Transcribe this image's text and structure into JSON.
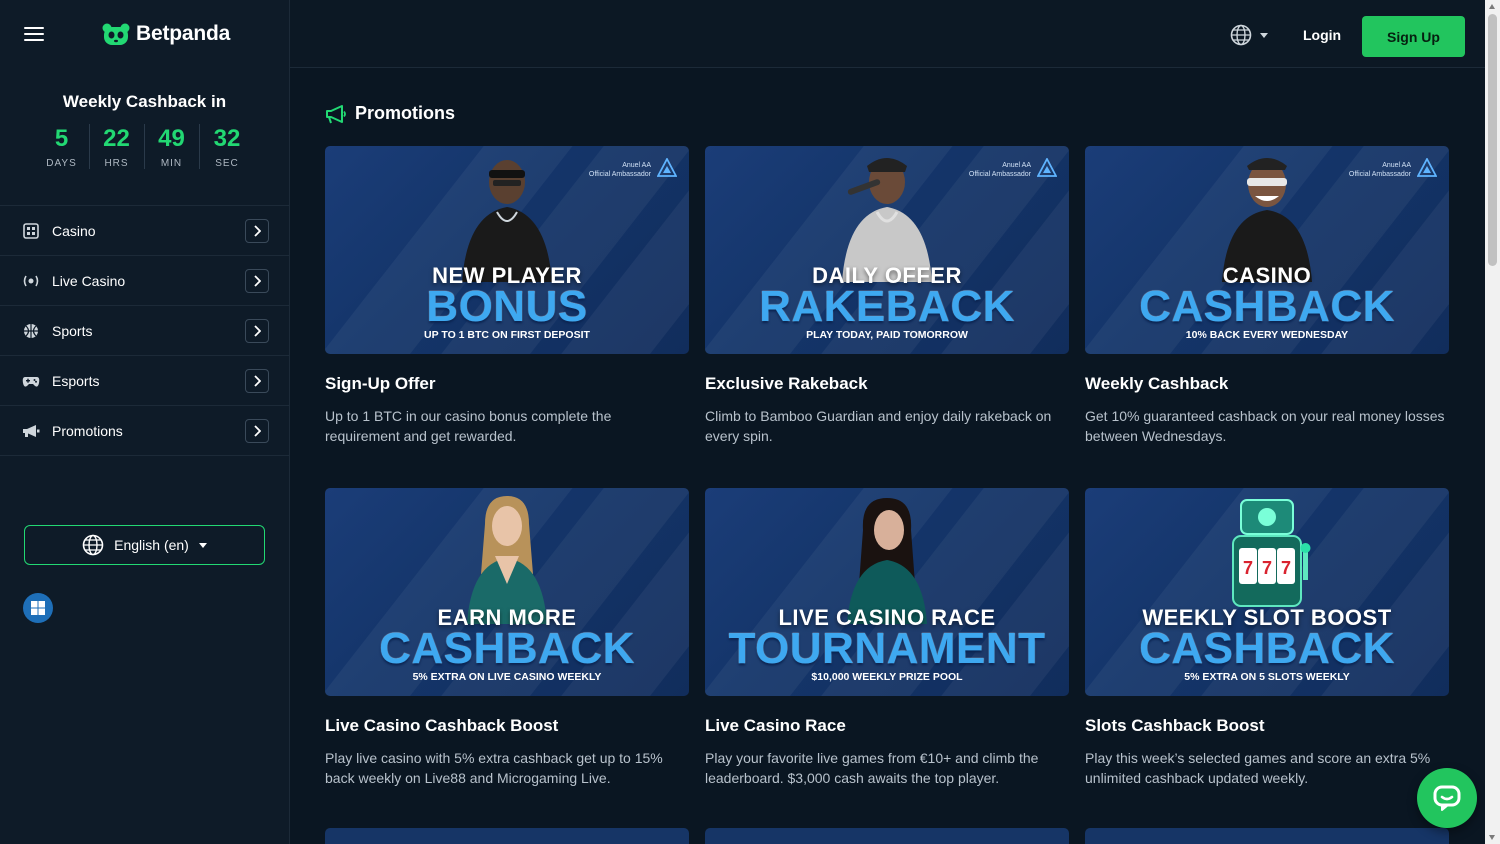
{
  "brand": {
    "name": "Betpanda",
    "accent": "#22d873"
  },
  "cashback_timer": {
    "title": "Weekly Cashback in",
    "units": [
      {
        "value": "5",
        "label": "DAYS"
      },
      {
        "value": "22",
        "label": "HRS"
      },
      {
        "value": "49",
        "label": "MIN"
      },
      {
        "value": "32",
        "label": "SEC"
      }
    ]
  },
  "sidebar": {
    "items": [
      {
        "label": "Casino",
        "icon": "casino-icon"
      },
      {
        "label": "Live Casino",
        "icon": "live-casino-icon"
      },
      {
        "label": "Sports",
        "icon": "sports-icon"
      },
      {
        "label": "Esports",
        "icon": "esports-icon"
      },
      {
        "label": "Promotions",
        "icon": "promotions-icon"
      }
    ],
    "language": "English (en)"
  },
  "header": {
    "login": "Login",
    "signup": "Sign Up"
  },
  "promotions": {
    "title": "Promotions",
    "cards": [
      {
        "line1": "NEW PLAYER",
        "line2": "BONUS",
        "line3": "UP TO 1 BTC ON FIRST DEPOSIT",
        "ambassador": "Anuel AA\nOfficial Ambassador",
        "title": "Sign-Up Offer",
        "desc": "Up to 1 BTC in our casino bonus complete the requirement and get rewarded."
      },
      {
        "line1": "DAILY OFFER",
        "line2": "RAKEBACK",
        "line3": "PLAY TODAY, PAID TOMORROW",
        "ambassador": "Anuel AA\nOfficial Ambassador",
        "title": "Exclusive Rakeback",
        "desc": "Climb to Bamboo Guardian and enjoy daily rakeback on every spin."
      },
      {
        "line1": "CASINO",
        "line2": "CASHBACK",
        "line3": "10% BACK EVERY WEDNESDAY",
        "ambassador": "Anuel AA\nOfficial Ambassador",
        "title": "Weekly Cashback",
        "desc": "Get 10% guaranteed cashback on your real money losses between Wednesdays."
      },
      {
        "line1": "EARN MORE",
        "line2": "CASHBACK",
        "line3": "5% EXTRA ON LIVE CASINO WEEKLY",
        "ambassador": "",
        "title": "Live Casino Cashback Boost",
        "desc": "Play live casino with 5% extra cashback get up to 15% back weekly on Live88 and Microgaming Live."
      },
      {
        "line1": "LIVE CASINO RACE",
        "line2": "TOURNAMENT",
        "line3": "$10,000 WEEKLY PRIZE POOL",
        "ambassador": "",
        "title": "Live Casino Race",
        "desc": "Play your favorite live games from €10+ and climb the leaderboard. $3,000 cash awaits the top player."
      },
      {
        "line1": "WEEKLY SLOT BOOST",
        "line2": "CASHBACK",
        "line3": "5% EXTRA ON 5 SLOTS WEEKLY",
        "ambassador": "",
        "title": "Slots Cashback Boost",
        "desc": "Play this week’s selected games and score an extra 5% unlimited cashback updated weekly."
      }
    ]
  }
}
